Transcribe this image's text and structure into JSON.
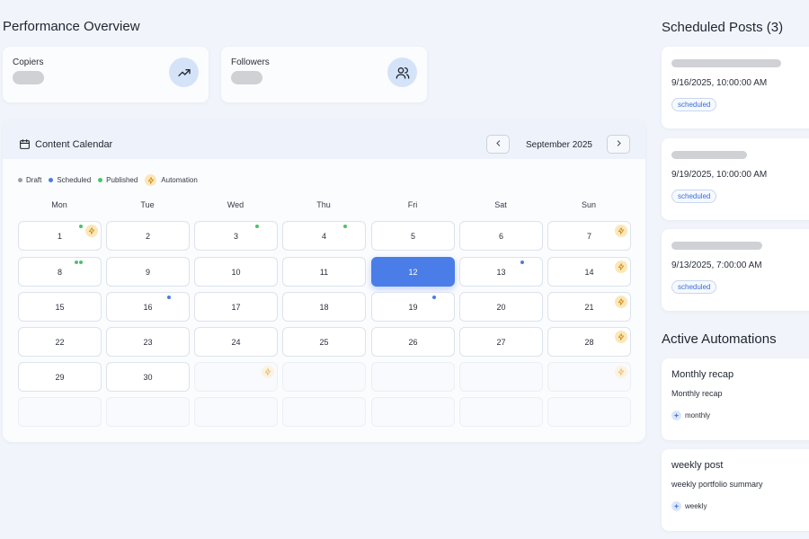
{
  "performance": {
    "title": "Performance Overview",
    "cards": [
      {
        "label": "Copiers",
        "icon": "trending-up-icon"
      },
      {
        "label": "Followers",
        "icon": "users-icon"
      }
    ]
  },
  "calendar": {
    "title": "Content Calendar",
    "month": "September 2025",
    "legend": {
      "draft": "Draft",
      "scheduled": "Scheduled",
      "published": "Published",
      "automation": "Automation"
    },
    "weekdays": [
      "Mon",
      "Tue",
      "Wed",
      "Thu",
      "Fri",
      "Sat",
      "Sun"
    ],
    "selected_day": "12",
    "days": [
      {
        "num": "1",
        "published": 1,
        "scheduled": 0,
        "automation": true
      },
      {
        "num": "2",
        "published": 0,
        "scheduled": 0,
        "automation": false
      },
      {
        "num": "3",
        "published": 1,
        "scheduled": 0,
        "automation": false
      },
      {
        "num": "4",
        "published": 1,
        "scheduled": 0,
        "automation": false
      },
      {
        "num": "5",
        "published": 0,
        "scheduled": 0,
        "automation": false
      },
      {
        "num": "6",
        "published": 0,
        "scheduled": 0,
        "automation": false
      },
      {
        "num": "7",
        "published": 0,
        "scheduled": 0,
        "automation": true
      },
      {
        "num": "8",
        "published": 2,
        "scheduled": 0,
        "automation": false
      },
      {
        "num": "9",
        "published": 0,
        "scheduled": 0,
        "automation": false
      },
      {
        "num": "10",
        "published": 0,
        "scheduled": 0,
        "automation": false
      },
      {
        "num": "11",
        "published": 0,
        "scheduled": 0,
        "automation": false
      },
      {
        "num": "12",
        "published": 0,
        "scheduled": 0,
        "automation": false
      },
      {
        "num": "13",
        "published": 0,
        "scheduled": 1,
        "automation": false
      },
      {
        "num": "14",
        "published": 0,
        "scheduled": 0,
        "automation": true
      },
      {
        "num": "15",
        "published": 0,
        "scheduled": 0,
        "automation": false
      },
      {
        "num": "16",
        "published": 0,
        "scheduled": 1,
        "automation": false
      },
      {
        "num": "17",
        "published": 0,
        "scheduled": 0,
        "automation": false
      },
      {
        "num": "18",
        "published": 0,
        "scheduled": 0,
        "automation": false
      },
      {
        "num": "19",
        "published": 0,
        "scheduled": 1,
        "automation": false
      },
      {
        "num": "20",
        "published": 0,
        "scheduled": 0,
        "automation": false
      },
      {
        "num": "21",
        "published": 0,
        "scheduled": 0,
        "automation": true
      },
      {
        "num": "22",
        "published": 0,
        "scheduled": 0,
        "automation": false
      },
      {
        "num": "23",
        "published": 0,
        "scheduled": 0,
        "automation": false
      },
      {
        "num": "24",
        "published": 0,
        "scheduled": 0,
        "automation": false
      },
      {
        "num": "25",
        "published": 0,
        "scheduled": 0,
        "automation": false
      },
      {
        "num": "26",
        "published": 0,
        "scheduled": 0,
        "automation": false
      },
      {
        "num": "27",
        "published": 0,
        "scheduled": 0,
        "automation": false
      },
      {
        "num": "28",
        "published": 0,
        "scheduled": 0,
        "automation": true
      },
      {
        "num": "29",
        "published": 0,
        "scheduled": 0,
        "automation": false
      },
      {
        "num": "30",
        "published": 0,
        "scheduled": 0,
        "automation": false
      }
    ],
    "trailing_automation_slots": [
      3,
      7
    ]
  },
  "scheduled_posts": {
    "title": "Scheduled Posts (3)",
    "items": [
      {
        "time": "9/16/2025, 10:00:00 AM",
        "status": "scheduled"
      },
      {
        "time": "9/19/2025, 10:00:00 AM",
        "status": "scheduled"
      },
      {
        "time": "9/13/2025, 7:00:00 AM",
        "status": "scheduled"
      }
    ]
  },
  "automations": {
    "title": "Active Automations",
    "items": [
      {
        "name": "Monthly recap",
        "description": "Monthly recap",
        "frequency": "monthly"
      },
      {
        "name": "weekly post",
        "description": "weekly portfolio summary",
        "frequency": "weekly"
      }
    ]
  },
  "colors": {
    "accent": "#4a7de8",
    "draft": "#9aa0a8",
    "scheduled": "#4a7de0",
    "published": "#4cc26a",
    "automation": "#fbe7b8"
  }
}
